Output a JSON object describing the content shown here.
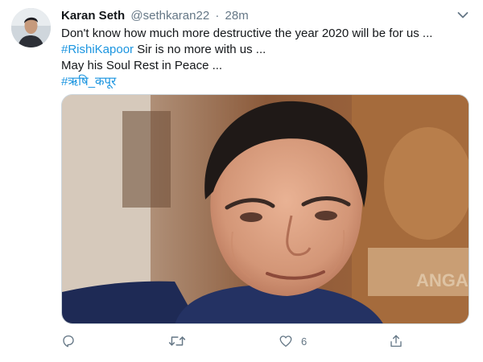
{
  "tweet": {
    "author_name": "Karan Seth",
    "author_handle": "@sethkaran22",
    "separator": "·",
    "time": "28m",
    "text_line_1": "Don't know how much more destructive the year 2020 will be for us ...",
    "hashtag_1": "#RishiKapoor",
    "text_line_2_rest": " Sir is no more with us ...",
    "text_line_3": "May his Soul Rest in Peace ...",
    "hashtag_2": "#ऋषि_कपूर",
    "media_watermark": "ANGAN",
    "like_count": "6"
  },
  "icons": {
    "menu": "chevron-down-icon",
    "reply": "reply-icon",
    "retweet": "retweet-icon",
    "like": "heart-icon",
    "share": "share-icon"
  },
  "colors": {
    "hashtag": "#1b95e0",
    "secondary_text": "#657786",
    "primary_text": "#14171a"
  }
}
